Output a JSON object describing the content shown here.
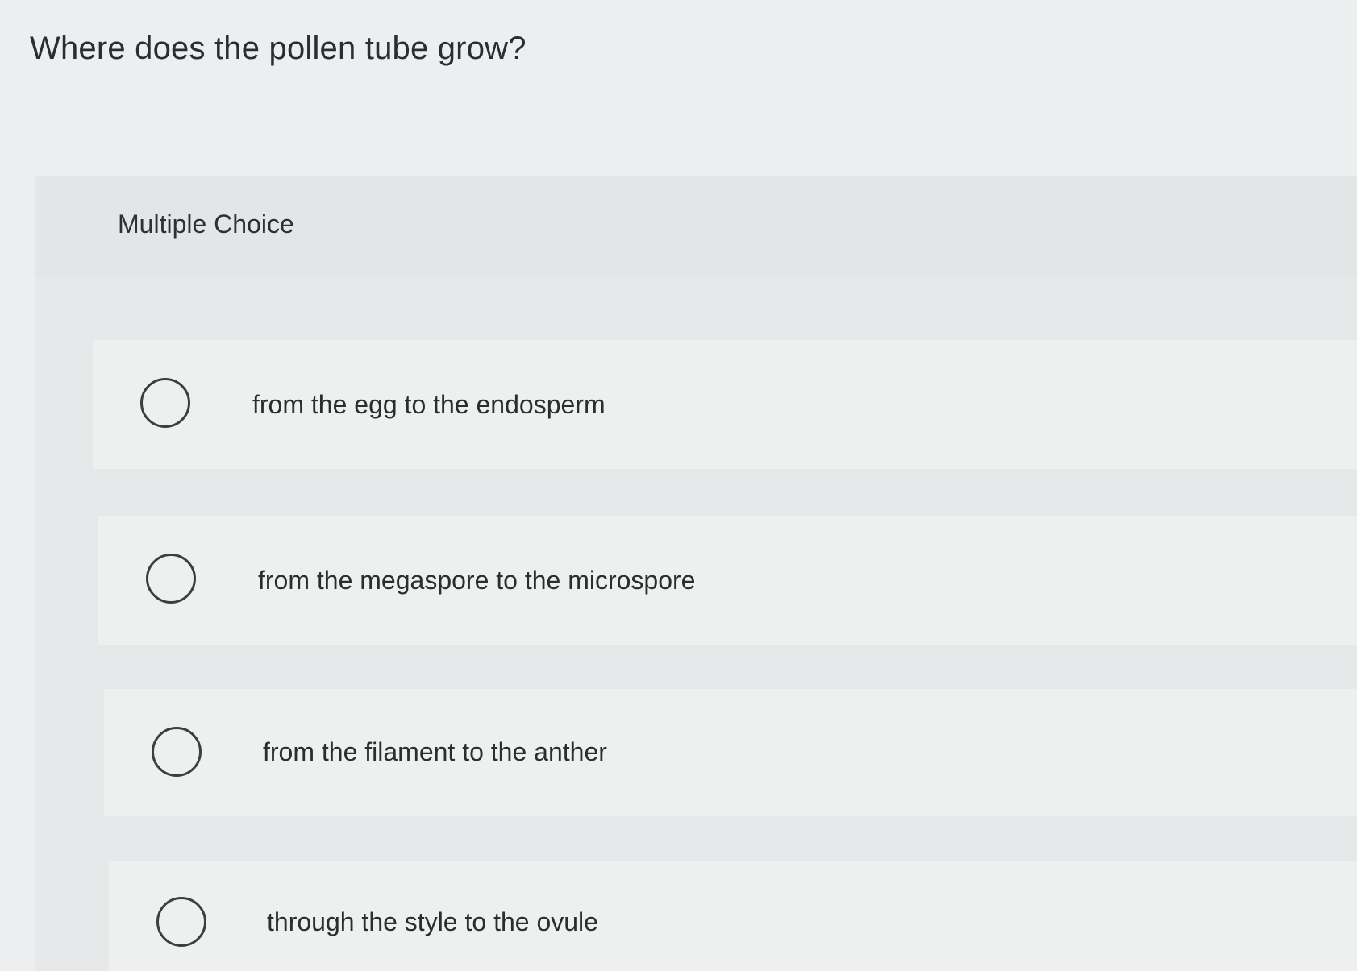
{
  "question": {
    "title": "Where does the pollen tube grow?",
    "type_label": "Multiple Choice"
  },
  "options": [
    {
      "label": "from the egg to the endosperm",
      "selected": false
    },
    {
      "label": "from the megaspore to the microspore",
      "selected": false
    },
    {
      "label": "from the filament to the anther",
      "selected": false
    },
    {
      "label": "through the style to the ovule",
      "selected": false
    }
  ]
}
